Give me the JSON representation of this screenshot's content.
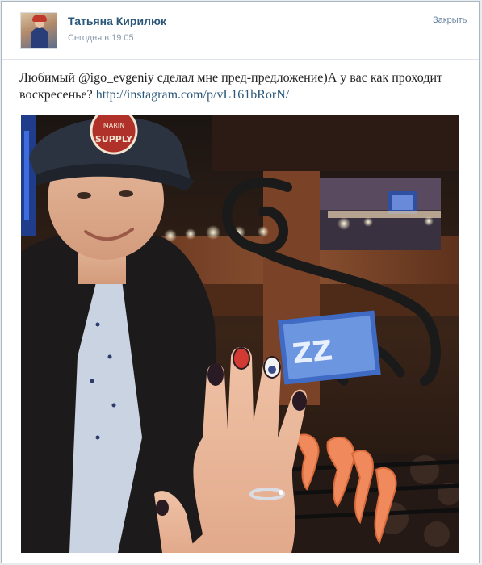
{
  "post": {
    "author": "Татьяна Кирилюк",
    "timestamp": "Сегодня в 19:05",
    "close_label": "Закрыть",
    "text": "Любимый @igo_evgeniy сделал мне пред-предложение)А у вас как проходит воскресенье? ",
    "link": "http://instagram.com/p/vL161bRorN/"
  },
  "photo": {
    "cap_patch_top": "MARIN",
    "cap_patch_bottom": "SUPPLY",
    "subject": "selfie-with-engagement-ring"
  },
  "icons": {
    "avatar": "user-avatar-photo",
    "cap_logo": "brand-patch-icon"
  },
  "colors": {
    "link": "#2b587a",
    "meta": "#8a9aab",
    "border": "#a9b6c4"
  }
}
